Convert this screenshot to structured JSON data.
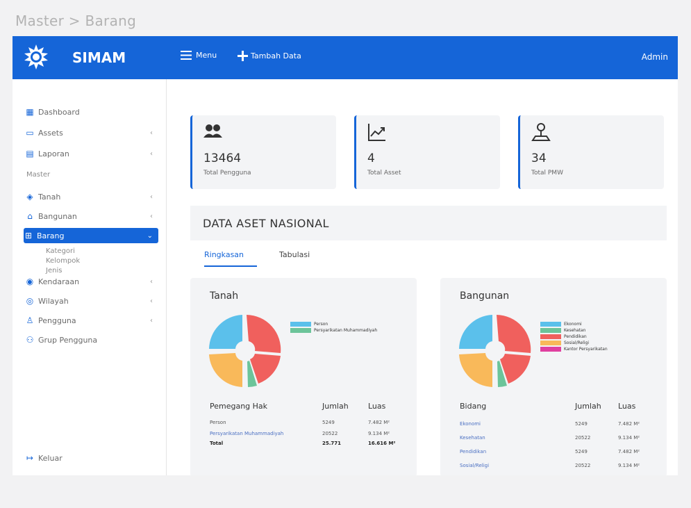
{
  "page_caption": "Master > Barang",
  "app": {
    "name": "SIMAM",
    "user": "Admin"
  },
  "toolbar": {
    "menu_label": "Menu",
    "add_label": "Tambah Data"
  },
  "sidebar": {
    "dashboard": "Dashboard",
    "assets": "Assets",
    "laporan": "Laporan",
    "master_section": "Master",
    "tanah": "Tanah",
    "bangunan": "Bangunan",
    "barang": "Barang",
    "barang_sub": [
      "Kategori",
      "Kelompok",
      "Jenis"
    ],
    "kendaraan": "Kendaraan",
    "wilayah": "Wilayah",
    "pengguna": "Pengguna",
    "grup_pengguna": "Grup Pengguna",
    "keluar": "Keluar"
  },
  "stats": [
    {
      "value": "13464",
      "label": "Total Pengguna",
      "icon": "users-icon"
    },
    {
      "value": "4",
      "label": "Total Asset",
      "icon": "trend-chart-icon"
    },
    {
      "value": "34",
      "label": "Total PMW",
      "icon": "location-pin-icon"
    }
  ],
  "section_title": "DATA ASET NASIONAL",
  "tabs": [
    "Ringkasan",
    "Tabulasi"
  ],
  "tanah": {
    "title": "Tanah",
    "legend": [
      {
        "label": "Person",
        "color": "#5bc0eb"
      },
      {
        "label": "Persyarikatan Muhammadiyah",
        "color": "#6cc49a"
      }
    ],
    "headers": [
      "Pemegang Hak",
      "Jumlah",
      "Luas"
    ],
    "rows": [
      {
        "name": "Person",
        "jumlah": "5249",
        "luas": "7.482 M²"
      },
      {
        "name": "Persyarikatan Muhammadiyah",
        "jumlah": "20522",
        "luas": "9.134 M²"
      }
    ],
    "total": {
      "name": "Total",
      "jumlah": "25.771",
      "luas": "16.616 M²"
    }
  },
  "bangunan": {
    "title": "Bangunan",
    "legend": [
      {
        "label": "Ekonomi",
        "color": "#5bc0eb"
      },
      {
        "label": "Kesehatan",
        "color": "#6cc49a"
      },
      {
        "label": "Pendidikan",
        "color": "#f0605d"
      },
      {
        "label": "Sosial/Religi",
        "color": "#f9b95a"
      },
      {
        "label": "Kantor Persyarikatan",
        "color": "#e040a0"
      }
    ],
    "headers": [
      "Bidang",
      "Jumlah",
      "Luas"
    ],
    "rows": [
      {
        "name": "Ekonomi",
        "jumlah": "5249",
        "luas": "7.482 M²"
      },
      {
        "name": "Kesehatan",
        "jumlah": "20522",
        "luas": "9.134 M²"
      },
      {
        "name": "Pendidikan",
        "jumlah": "5249",
        "luas": "7.482 M²"
      },
      {
        "name": "Sosial/Religi",
        "jumlah": "20522",
        "luas": "9.134 M²"
      }
    ]
  },
  "colors": {
    "primary": "#1565d8",
    "donut_red": "#f0605d",
    "donut_blue": "#5bc0eb",
    "donut_orange": "#f9b95a",
    "donut_green": "#6cc49a"
  }
}
